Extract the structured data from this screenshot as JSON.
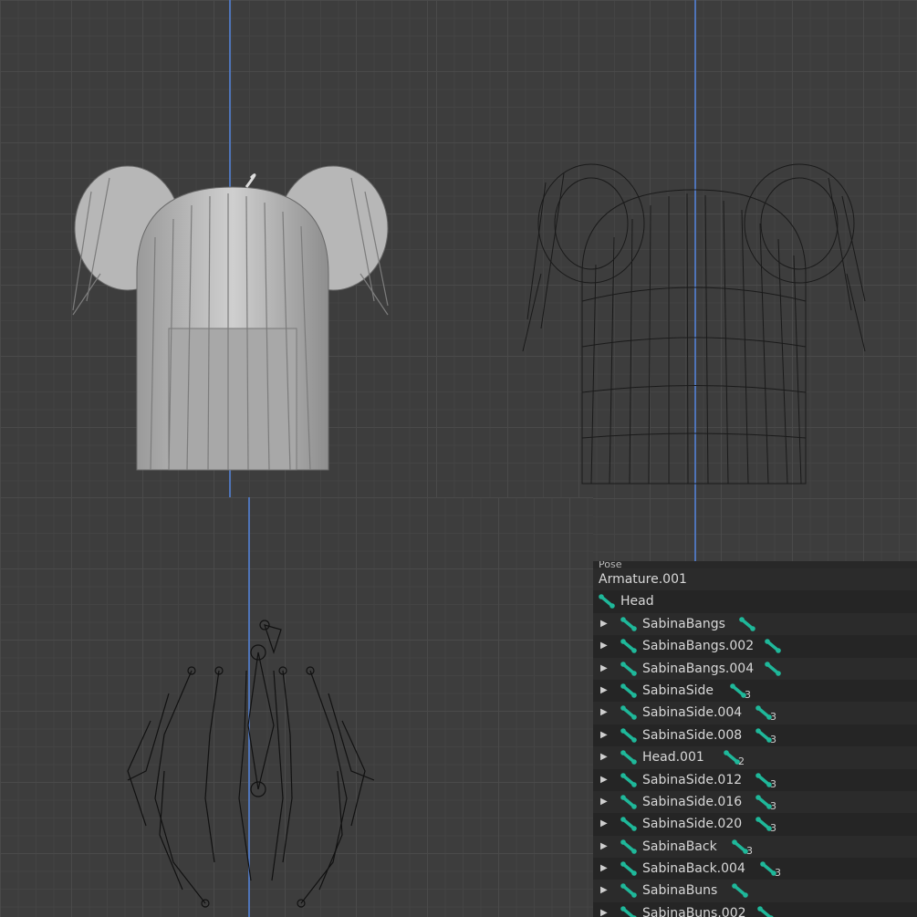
{
  "viewports": {
    "solid": "solid-shaded-hair-view",
    "wire": "wireframe-hair-view",
    "armature": "armature-bones-view"
  },
  "outliner": {
    "header_cut": "Pose",
    "armature": "Armature.001",
    "root_bone": "Head",
    "items": [
      {
        "label": "SabinaBangs",
        "count": ""
      },
      {
        "label": "SabinaBangs.002",
        "count": ""
      },
      {
        "label": "SabinaBangs.004",
        "count": ""
      },
      {
        "label": "SabinaSide",
        "count": "3"
      },
      {
        "label": "SabinaSide.004",
        "count": "3"
      },
      {
        "label": "SabinaSide.008",
        "count": "3"
      },
      {
        "label": "Head.001",
        "count": "2"
      },
      {
        "label": "SabinaSide.012",
        "count": "3"
      },
      {
        "label": "SabinaSide.016",
        "count": "3"
      },
      {
        "label": "SabinaSide.020",
        "count": "3"
      },
      {
        "label": "SabinaBack",
        "count": "3"
      },
      {
        "label": "SabinaBack.004",
        "count": "3"
      },
      {
        "label": "SabinaBuns",
        "count": ""
      },
      {
        "label": "SabinaBuns.002",
        "count": ""
      }
    ]
  },
  "colors": {
    "bone_icon": "#1fb89a",
    "axis": "#4f74b8",
    "panel_bg": "#282828"
  }
}
